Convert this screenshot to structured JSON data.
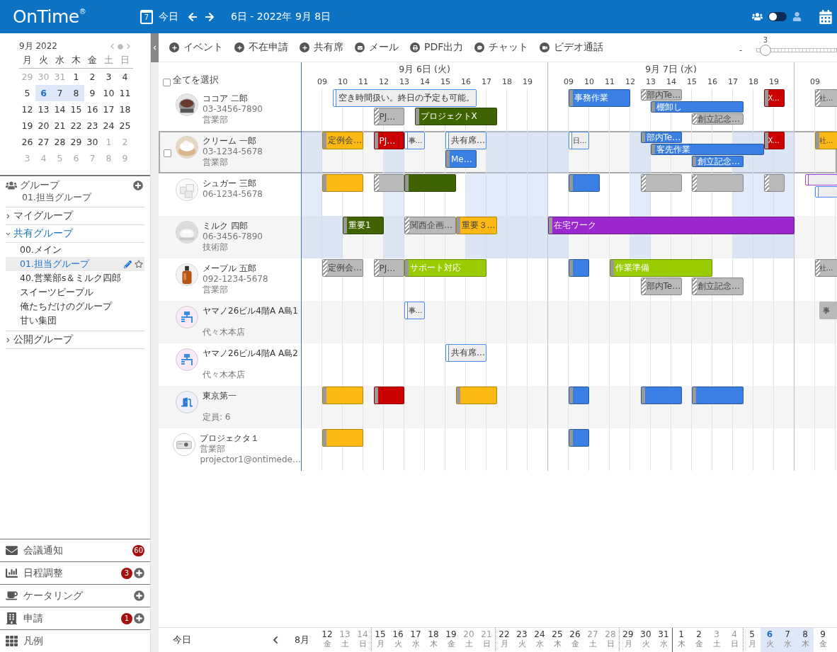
{
  "header": {
    "logo": "OnTime",
    "logo_mark": "®",
    "today_icon_day": "7",
    "today": "今日",
    "range": "6日 - 2022年 9月 8日",
    "view_toggle": {
      "on": false
    }
  },
  "mini_calendar": {
    "title": "9月 2022",
    "weekdays": [
      {
        "label": "月",
        "weekend": false
      },
      {
        "label": "火",
        "weekend": false
      },
      {
        "label": "水",
        "weekend": false
      },
      {
        "label": "木",
        "weekend": false
      },
      {
        "label": "金",
        "weekend": false
      },
      {
        "label": "土",
        "weekend": true
      },
      {
        "label": "日",
        "weekend": true
      }
    ],
    "weeks": [
      [
        {
          "d": "29",
          "muted": true,
          "selected": false,
          "today": false
        },
        {
          "d": "30",
          "muted": true,
          "selected": false,
          "today": false
        },
        {
          "d": "31",
          "muted": true,
          "selected": false,
          "today": false
        },
        {
          "d": "1",
          "muted": false,
          "selected": false,
          "today": false
        },
        {
          "d": "2",
          "muted": false,
          "selected": false,
          "today": false
        },
        {
          "d": "3",
          "muted": false,
          "selected": false,
          "today": false
        },
        {
          "d": "4",
          "muted": false,
          "selected": false,
          "today": false
        }
      ],
      [
        {
          "d": "5",
          "muted": false,
          "selected": false,
          "today": false
        },
        {
          "d": "6",
          "muted": false,
          "selected": true,
          "today": true
        },
        {
          "d": "7",
          "muted": false,
          "selected": true,
          "today": false
        },
        {
          "d": "8",
          "muted": false,
          "selected": true,
          "today": false
        },
        {
          "d": "9",
          "muted": false,
          "selected": false,
          "today": false
        },
        {
          "d": "10",
          "muted": false,
          "selected": false,
          "today": false
        },
        {
          "d": "11",
          "muted": false,
          "selected": false,
          "today": false
        }
      ],
      [
        {
          "d": "12",
          "muted": false,
          "selected": false,
          "today": false
        },
        {
          "d": "13",
          "muted": false,
          "selected": false,
          "today": false
        },
        {
          "d": "14",
          "muted": false,
          "selected": false,
          "today": false
        },
        {
          "d": "15",
          "muted": false,
          "selected": false,
          "today": false
        },
        {
          "d": "16",
          "muted": false,
          "selected": false,
          "today": false
        },
        {
          "d": "17",
          "muted": false,
          "selected": false,
          "today": false
        },
        {
          "d": "18",
          "muted": false,
          "selected": false,
          "today": false
        }
      ],
      [
        {
          "d": "19",
          "muted": false,
          "selected": false,
          "today": false
        },
        {
          "d": "20",
          "muted": false,
          "selected": false,
          "today": false
        },
        {
          "d": "21",
          "muted": false,
          "selected": false,
          "today": false
        },
        {
          "d": "22",
          "muted": false,
          "selected": false,
          "today": false
        },
        {
          "d": "23",
          "muted": false,
          "selected": false,
          "today": false
        },
        {
          "d": "24",
          "muted": false,
          "selected": false,
          "today": false
        },
        {
          "d": "25",
          "muted": false,
          "selected": false,
          "today": false
        }
      ],
      [
        {
          "d": "26",
          "muted": false,
          "selected": false,
          "today": false
        },
        {
          "d": "27",
          "muted": false,
          "selected": false,
          "today": false
        },
        {
          "d": "28",
          "muted": false,
          "selected": false,
          "today": false
        },
        {
          "d": "29",
          "muted": false,
          "selected": false,
          "today": false
        },
        {
          "d": "30",
          "muted": false,
          "selected": false,
          "today": false
        },
        {
          "d": "1",
          "muted": true,
          "selected": false,
          "today": false
        },
        {
          "d": "2",
          "muted": true,
          "selected": false,
          "today": false
        }
      ],
      [
        {
          "d": "3",
          "muted": true,
          "selected": false,
          "today": false
        },
        {
          "d": "4",
          "muted": true,
          "selected": false,
          "today": false
        },
        {
          "d": "5",
          "muted": true,
          "selected": false,
          "today": false
        },
        {
          "d": "6",
          "muted": true,
          "selected": false,
          "today": false
        },
        {
          "d": "7",
          "muted": true,
          "selected": false,
          "today": false
        },
        {
          "d": "8",
          "muted": true,
          "selected": false,
          "today": false
        },
        {
          "d": "9",
          "muted": true,
          "selected": false,
          "today": false
        }
      ]
    ]
  },
  "groups": {
    "title": "グループ",
    "current": "01.担当グループ",
    "tree": [
      {
        "label": "マイグループ",
        "expanded": false
      },
      {
        "label": "共有グループ",
        "expanded": true,
        "children": [
          {
            "label": "00.メイン",
            "selected": false
          },
          {
            "label": "01.担当グループ",
            "selected": true
          },
          {
            "label": "40.営業部s＆ミルク四郎",
            "selected": false
          },
          {
            "label": "スイーツピープル",
            "selected": false
          },
          {
            "label": "俺たちだけのグループ",
            "selected": false
          },
          {
            "label": "甘い集団",
            "selected": false
          }
        ]
      },
      {
        "label": "公開グループ",
        "expanded": false
      }
    ]
  },
  "panels": [
    {
      "label": "会議通知",
      "badge": "60",
      "add": false
    },
    {
      "label": "日程調整",
      "badge": "3",
      "add": true
    },
    {
      "label": "ケータリング",
      "add": true
    },
    {
      "label": "申請",
      "badge": "1",
      "add": true
    },
    {
      "label": "凡例",
      "add": false
    }
  ],
  "toolbar": [
    {
      "label": "イベント"
    },
    {
      "label": "不在申請"
    },
    {
      "label": "共有席"
    },
    {
      "label": "メール"
    },
    {
      "label": "PDF出力"
    },
    {
      "label": "チャット"
    },
    {
      "label": "ビデオ通話"
    }
  ],
  "zoom": {
    "minus": "-",
    "value": "3",
    "level": 0.05
  },
  "select_all": {
    "label": "全てを選択",
    "checked": false
  },
  "timeline": {
    "days": [
      {
        "label": "9月 6日 (火)",
        "hours": [
          "09",
          "10",
          "11",
          "12",
          "13",
          "14",
          "15",
          "16",
          "17",
          "18",
          "19"
        ]
      },
      {
        "label": "9月 7日 (水)",
        "hours": [
          "09",
          "10",
          "11",
          "12",
          "13",
          "14",
          "15",
          "16",
          "17",
          "18",
          "19"
        ]
      },
      {
        "hours": [
          "09"
        ]
      }
    ]
  },
  "rows": [
    {
      "name": "ココア 二郎",
      "line_2": "03-3456-7890",
      "line_3": "営業部",
      "selected": false,
      "events": [
        {
          "title": "空き時間扱い。終日の予定も可能。",
          "kind": "free",
          "color": "#4a8be8"
        },
        {
          "title": "PJ…",
          "kind": "tentative"
        },
        {
          "title": "プロジェクトX",
          "kind": "solid",
          "color": "#3f6300"
        },
        {
          "title": "事務作業",
          "kind": "solid",
          "color": "#3a80e4"
        },
        {
          "title": "部内Te…",
          "kind": "tentative"
        },
        {
          "title": "棚卸し",
          "kind": "solid",
          "color": "#3a80e4"
        },
        {
          "title": "創立記念…",
          "kind": "tentative"
        },
        {
          "title": "X…",
          "kind": "solid",
          "color": "#cc0000"
        },
        {
          "title": "社…",
          "kind": "tentative"
        }
      ]
    },
    {
      "name": "クリーム 一郎",
      "line_2": "03-1234-5678",
      "line_3": "営業部",
      "selected": true,
      "events": [
        {
          "title": "定例会…",
          "kind": "solid",
          "color": "#fdb913"
        },
        {
          "title": "PJ…",
          "kind": "solid",
          "color": "#cc0000"
        },
        {
          "title": "事…",
          "kind": "free",
          "color": "#4a8be8"
        },
        {
          "title": "共有席…",
          "kind": "free",
          "color": "#4a8be8"
        },
        {
          "title": "Me…",
          "kind": "solid",
          "color": "#3a80e4"
        },
        {
          "title": "日…",
          "kind": "free",
          "color": "#4a8be8"
        },
        {
          "title": "部内Te…",
          "kind": "solid",
          "color": "#3a80e4"
        },
        {
          "title": "客先作業",
          "kind": "solid",
          "color": "#3a80e4"
        },
        {
          "title": "創立記念…",
          "kind": "solid",
          "color": "#3a80e4"
        },
        {
          "title": "X…",
          "kind": "solid",
          "color": "#cc0000"
        },
        {
          "title": "社…",
          "kind": "solid",
          "color": "#fdb913"
        }
      ]
    },
    {
      "name": "シュガー 三郎",
      "line_2": "06-1234-5678",
      "selected": false,
      "events": [
        {
          "kind": "solid",
          "color": "#fdb913"
        },
        {
          "kind": "tentative"
        },
        {
          "kind": "solid",
          "color": "#3f6300"
        },
        {
          "kind": "solid",
          "color": "#3a80e4"
        },
        {
          "kind": "tentative"
        },
        {
          "kind": "tentative"
        },
        {
          "kind": "tentative"
        },
        {
          "kind": "free",
          "color": "#a040d8"
        },
        {
          "kind": "free",
          "color": "#4a8be8"
        }
      ]
    },
    {
      "name": "ミルク 四郎",
      "line_2": "06-3456-7890",
      "line_3": "技術部",
      "selected": false,
      "events": [
        {
          "title": "重要1",
          "kind": "solid",
          "color": "#3f6300"
        },
        {
          "title": "関西企画…",
          "kind": "tentative"
        },
        {
          "title": "重要３…",
          "kind": "solid",
          "color": "#fdb913"
        },
        {
          "title": "在宅ワーク",
          "kind": "solid",
          "color": "#9b27cf"
        }
      ]
    },
    {
      "name": "メープル 五郎",
      "line_2": "092-1234-5678",
      "line_3": "営業部",
      "selected": false,
      "events": [
        {
          "title": "定例会…",
          "kind": "tentative"
        },
        {
          "title": "PJ…",
          "kind": "tentative"
        },
        {
          "title": "サポート対応",
          "kind": "solid",
          "color": "#99cc00"
        },
        {
          "kind": "solid",
          "color": "#3a80e4"
        },
        {
          "title": "作業準備",
          "kind": "solid",
          "color": "#99cc00"
        },
        {
          "title": "部内Te…",
          "kind": "tentative"
        },
        {
          "title": "創立記念…",
          "kind": "tentative"
        },
        {
          "title": "社…",
          "kind": "tentative"
        }
      ]
    },
    {
      "name": "ヤマノ26ビル4階A A島1",
      "line_3": "代々木本店",
      "selected": false,
      "events": [
        {
          "title": "事…",
          "kind": "free",
          "color": "#4a8be8"
        },
        {
          "title": "事",
          "kind": "plain"
        }
      ]
    },
    {
      "name": "ヤマノ26ビル4階A A島2",
      "line_3": "代々木本店",
      "selected": false,
      "events": [
        {
          "title": "共有席…",
          "kind": "free",
          "color": "#4a8be8"
        }
      ]
    },
    {
      "name": "東京第一",
      "line_3": "定員: 6",
      "selected": false,
      "events": [
        {
          "kind": "solid",
          "color": "#fdb913"
        },
        {
          "kind": "solid",
          "color": "#cc0000"
        },
        {
          "kind": "solid",
          "color": "#fdb913"
        },
        {
          "kind": "solid",
          "color": "#3a80e4"
        },
        {
          "kind": "solid",
          "color": "#3a80e4"
        },
        {
          "kind": "solid",
          "color": "#3a80e4"
        }
      ]
    },
    {
      "name": "プロジェクタ１",
      "line_2": "営業部",
      "line_3": "projector1@ontimede…",
      "selected": false,
      "events": [
        {
          "kind": "solid",
          "color": "#fdb913"
        },
        {
          "kind": "solid",
          "color": "#3a80e4"
        }
      ]
    }
  ],
  "footer": {
    "today": "今日",
    "month": "8月",
    "dates": [
      {
        "d": "12",
        "w": "金",
        "weekend": false,
        "selected": false,
        "today": false
      },
      {
        "d": "13",
        "w": "土",
        "weekend": true,
        "selected": false,
        "today": false
      },
      {
        "d": "14",
        "w": "日",
        "weekend": true,
        "selected": false,
        "today": false
      },
      {
        "d": "15",
        "w": "月",
        "weekend": false,
        "selected": false,
        "today": false
      },
      {
        "d": "16",
        "w": "火",
        "weekend": false,
        "selected": false,
        "today": false
      },
      {
        "d": "17",
        "w": "水",
        "weekend": false,
        "selected": false,
        "today": false
      },
      {
        "d": "18",
        "w": "木",
        "weekend": false,
        "selected": false,
        "today": false
      },
      {
        "d": "19",
        "w": "金",
        "weekend": false,
        "selected": false,
        "today": false
      },
      {
        "d": "20",
        "w": "土",
        "weekend": true,
        "selected": false,
        "today": false
      },
      {
        "d": "21",
        "w": "日",
        "weekend": true,
        "selected": false,
        "today": false
      },
      {
        "d": "22",
        "w": "月",
        "weekend": false,
        "selected": false,
        "today": false
      },
      {
        "d": "23",
        "w": "火",
        "weekend": false,
        "selected": false,
        "today": false
      },
      {
        "d": "24",
        "w": "水",
        "weekend": false,
        "selected": false,
        "today": false
      },
      {
        "d": "25",
        "w": "木",
        "weekend": false,
        "selected": false,
        "today": false
      },
      {
        "d": "26",
        "w": "金",
        "weekend": false,
        "selected": false,
        "today": false
      },
      {
        "d": "27",
        "w": "土",
        "weekend": true,
        "selected": false,
        "today": false
      },
      {
        "d": "28",
        "w": "日",
        "weekend": true,
        "selected": false,
        "today": false
      },
      {
        "d": "29",
        "w": "月",
        "weekend": false,
        "selected": false,
        "today": false
      },
      {
        "d": "30",
        "w": "火",
        "weekend": false,
        "selected": false,
        "today": false
      },
      {
        "d": "31",
        "w": "水",
        "weekend": false,
        "selected": false,
        "today": false
      },
      {
        "d": "1",
        "w": "木",
        "weekend": false,
        "selected": false,
        "today": false
      },
      {
        "d": "2",
        "w": "金",
        "weekend": false,
        "selected": false,
        "today": false
      },
      {
        "d": "3",
        "w": "土",
        "weekend": true,
        "selected": false,
        "today": false
      },
      {
        "d": "4",
        "w": "日",
        "weekend": true,
        "selected": false,
        "today": false
      },
      {
        "d": "5",
        "w": "月",
        "weekend": false,
        "selected": false,
        "today": false
      },
      {
        "d": "6",
        "w": "火",
        "weekend": false,
        "selected": true,
        "today": true
      },
      {
        "d": "7",
        "w": "水",
        "weekend": false,
        "selected": true,
        "today": false
      },
      {
        "d": "8",
        "w": "木",
        "weekend": false,
        "selected": true,
        "today": false
      },
      {
        "d": "9",
        "w": "金",
        "weekend": false,
        "selected": false,
        "today": false
      }
    ]
  }
}
